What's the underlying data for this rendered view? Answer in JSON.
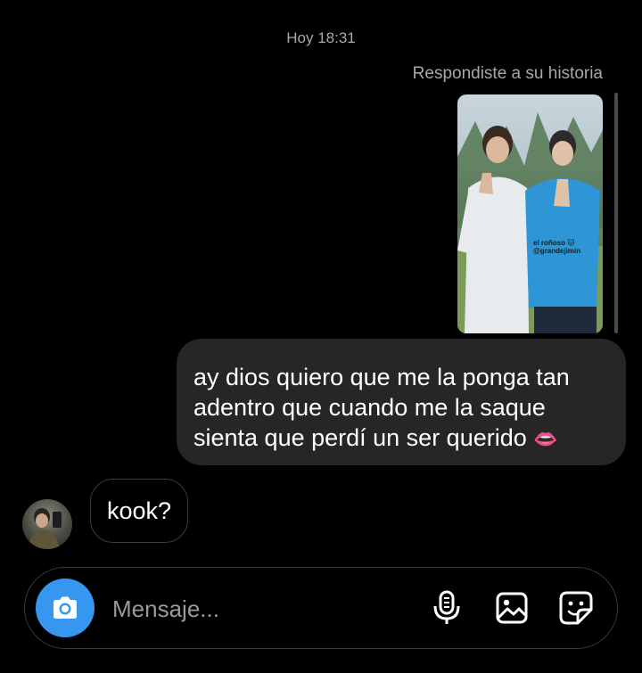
{
  "thread": {
    "timestamp": "Hoy 18:31",
    "reply_note": "Respondiste a su historia",
    "story": {
      "caption_line1": "el roñoso 🐱",
      "caption_line2": "@grandejimin"
    },
    "outgoing": {
      "line1": "ay dios quiero que me la ponga tan",
      "line2": "adentro que cuando me la saque",
      "line3": "sienta que perdí un ser querido",
      "emoji": "👄"
    },
    "incoming": {
      "text": "kook?"
    }
  },
  "composer": {
    "placeholder": "Mensaje...",
    "camera_icon": "camera-icon",
    "mic_icon": "microphone-icon",
    "gallery_icon": "image-icon",
    "sticker_icon": "sticker-icon",
    "accent_color": "#3797f0"
  }
}
